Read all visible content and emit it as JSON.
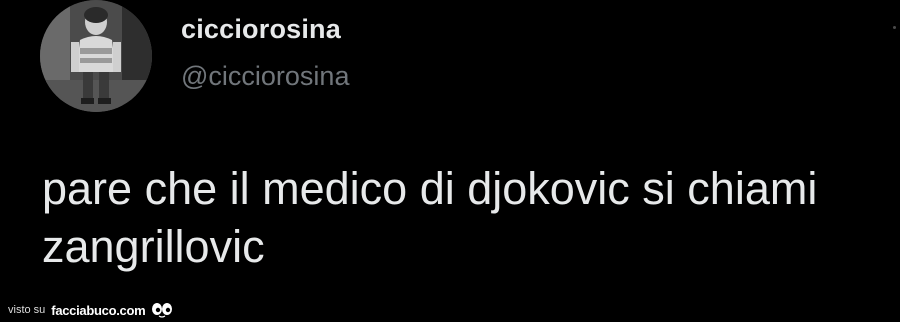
{
  "tweet": {
    "display_name": "cicciorosina",
    "handle": "@cicciorosina",
    "text": "pare che il medico di djokovic si chiami zangrillovic",
    "avatar_icon": "profile-photo-child-bw"
  },
  "watermark": {
    "prefix": "visto su",
    "site": "facciabuco.com",
    "logo_icon": "eyes-icon"
  },
  "colors": {
    "background": "#000000",
    "text_primary": "#e7e9ea",
    "text_secondary": "#71767b"
  }
}
